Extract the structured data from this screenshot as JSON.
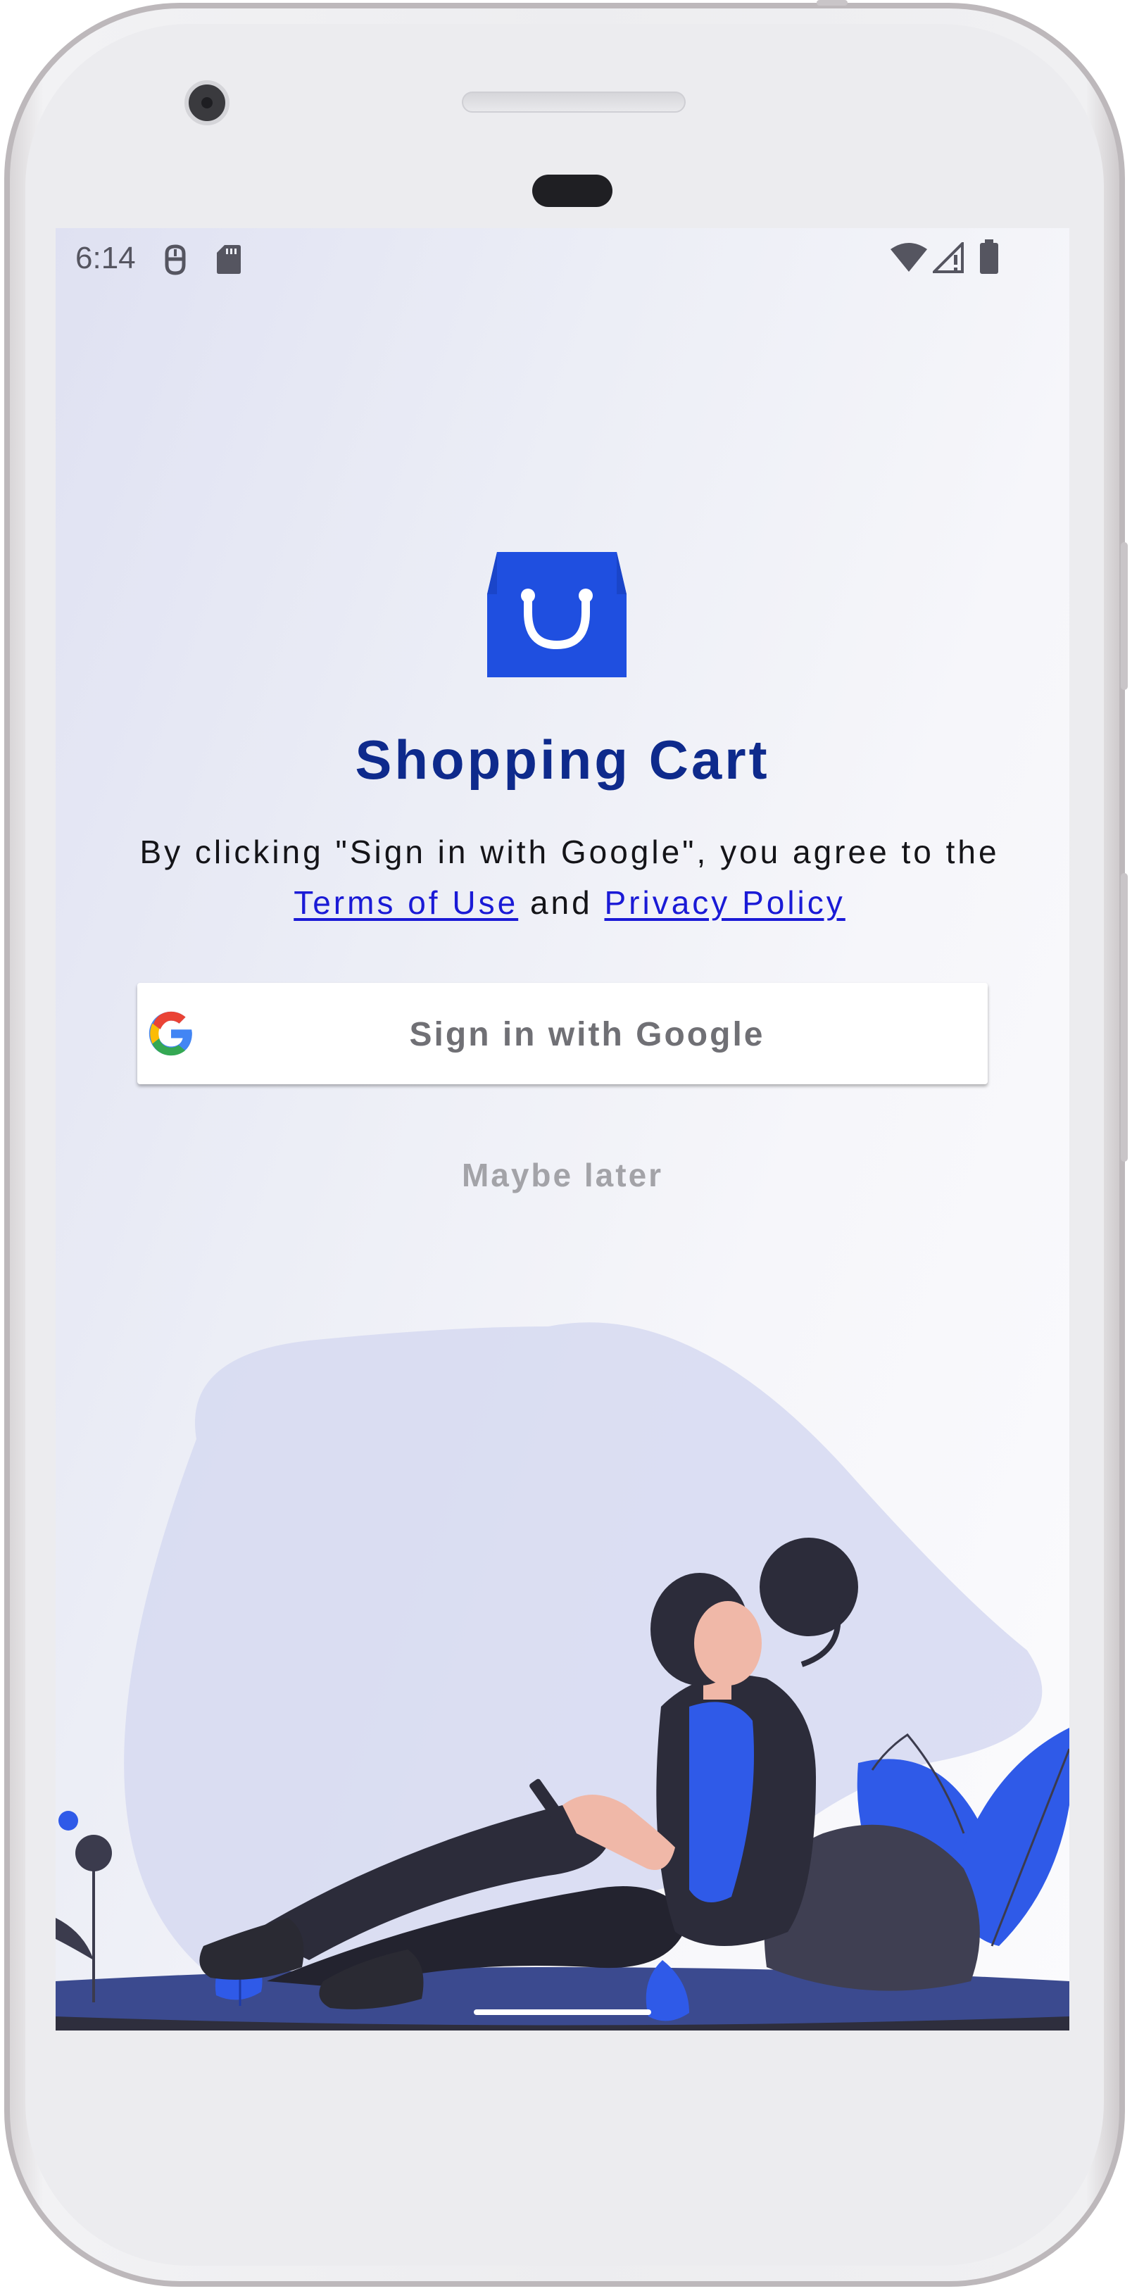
{
  "status_bar": {
    "time": "6:14",
    "left_icons": [
      "usb-debug-icon",
      "sd-card-icon"
    ],
    "right_icons": [
      "wifi-icon",
      "cellular-icon",
      "battery-icon"
    ]
  },
  "app": {
    "logo_icon": "shopping-bag-icon",
    "title": "Shopping Cart"
  },
  "terms": {
    "prefix": "By clicking \"Sign in with Google\", you agree to the ",
    "terms_link": "Terms of Use",
    "middle": " and ",
    "privacy_link": "Privacy Policy"
  },
  "google_button": {
    "icon": "google-icon",
    "label": "Sign in with Google"
  },
  "maybe_later": {
    "label": "Maybe later"
  },
  "illustration": {
    "description_icon": "woman-with-phone-illustration"
  },
  "colors": {
    "brand_blue": "#1f4fe0",
    "title_blue": "#0e2a8c",
    "link_blue": "#1a1ad6",
    "muted_gray": "#a3a3a8"
  }
}
